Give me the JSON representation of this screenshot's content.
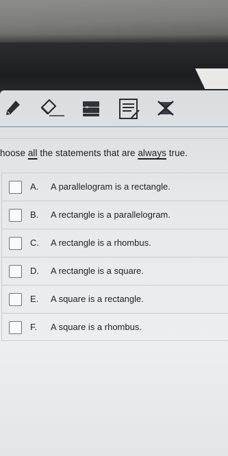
{
  "toolbar": {
    "tools": [
      {
        "icon": "pencil-icon"
      },
      {
        "icon": "eraser-icon"
      },
      {
        "icon": "highlighter-icon"
      },
      {
        "icon": "notes-icon"
      },
      {
        "icon": "cross-out-icon"
      }
    ]
  },
  "question": {
    "pre": "hoose ",
    "all": "all",
    "mid": " the statements that are ",
    "always": "always",
    "post": " true."
  },
  "options": [
    {
      "letter": "A.",
      "text": "A parallelogram is a rectangle."
    },
    {
      "letter": "B.",
      "text": "A rectangle is a parallelogram."
    },
    {
      "letter": "C.",
      "text": "A rectangle is a rhombus."
    },
    {
      "letter": "D.",
      "text": "A rectangle is a square."
    },
    {
      "letter": "E.",
      "text": "A square is a rectangle."
    },
    {
      "letter": "F.",
      "text": "A square is a rhombus."
    }
  ],
  "colors": {
    "screen_bg": "#e6e8ea",
    "toolbar_accent": "#9fb3c2",
    "text": "#1b1c1e"
  }
}
